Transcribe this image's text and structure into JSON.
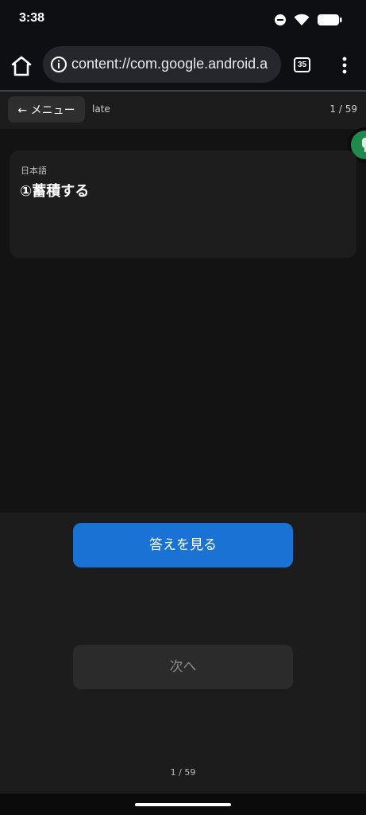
{
  "status_bar": {
    "time": "3:38",
    "icons": [
      "do-not-disturb-icon",
      "wifi-icon",
      "battery-icon"
    ]
  },
  "browser": {
    "url": "content://com.google.android.a",
    "tab_count": "35",
    "icons": [
      "home-icon",
      "site-info-icon",
      "more-vert-icon"
    ]
  },
  "header": {
    "menu_label": "← メニュー",
    "title": "late",
    "progress": "1 / 59"
  },
  "card": {
    "label": "日本語",
    "question": "①蓄積する"
  },
  "actions": {
    "show_answer": "答えを見る",
    "next": "次へ"
  },
  "footer": {
    "progress": "1 / 59"
  },
  "colors": {
    "accent": "#1a73d4",
    "background": "#131313",
    "panel": "#1c1c1c",
    "card": "#1d1d1d",
    "mic_fab": "#1f8a4c"
  }
}
